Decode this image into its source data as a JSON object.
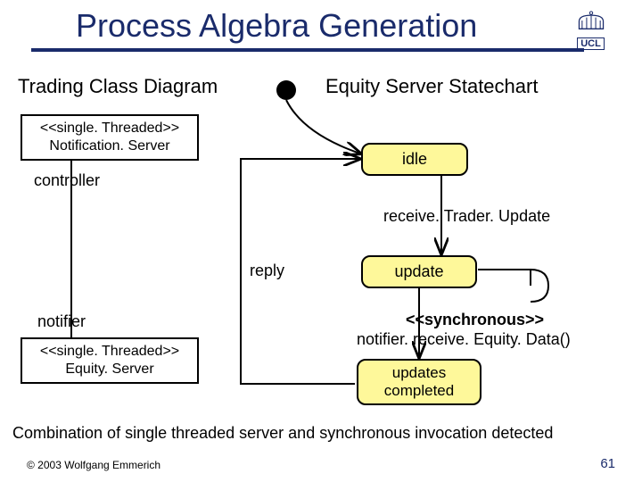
{
  "title": "Process Algebra Generation",
  "logo_text": "UCL",
  "left": {
    "section_title": "Trading Class Diagram",
    "notification_server": {
      "stereotype": "<<single. Threaded>>",
      "name": "Notification. Server"
    },
    "role_controller": "controller",
    "role_notifier": "notifier",
    "equity_server": {
      "stereotype": "<<single. Threaded>>",
      "name": "Equity. Server"
    }
  },
  "right": {
    "section_title": "Equity Server Statechart",
    "state_idle": "idle",
    "event_receive": "receive. Trader. Update",
    "label_reply": "reply",
    "state_update": "update",
    "call_stereotype": "<<synchronous>>",
    "call_text": "notifier. receive. Equity. Data()",
    "state_completed": "updates\ncompleted"
  },
  "caption": "Combination of single threaded server and synchronous invocation detected",
  "footer": {
    "copyright": "© 2003 Wolfgang Emmerich",
    "page": "61"
  }
}
